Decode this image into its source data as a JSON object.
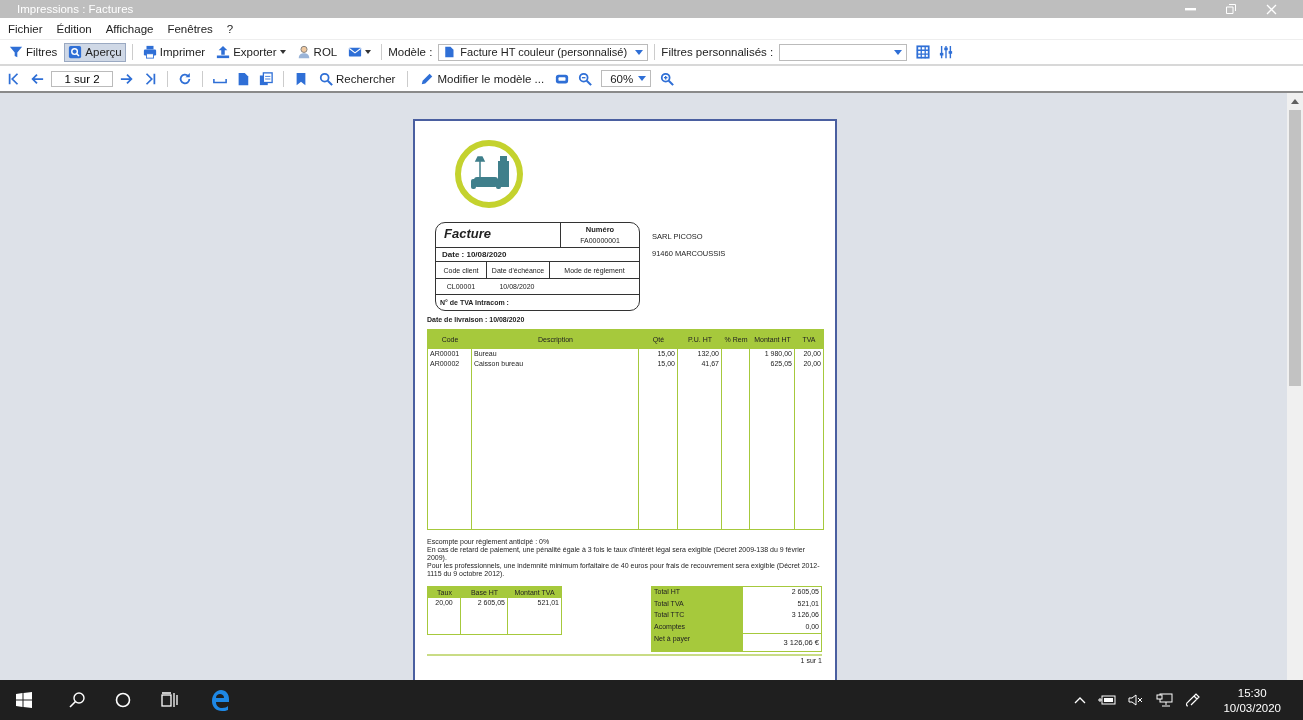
{
  "window": {
    "title": "Impressions : Factures"
  },
  "menu": [
    "Fichier",
    "Édition",
    "Affichage",
    "Fenêtres",
    "?"
  ],
  "toolbar": {
    "buttons": [
      {
        "label": "Filtres",
        "kind": "toggle",
        "selected": false
      },
      {
        "label": "Aperçu",
        "kind": "toggle",
        "selected": true
      },
      {
        "label": "Imprimer",
        "kind": "button"
      },
      {
        "label": "Exporter",
        "kind": "dropdown"
      },
      {
        "label": "ROL",
        "kind": "button"
      },
      {
        "kind": "dropdown"
      }
    ],
    "model_label": "Modèle :",
    "model_value": "Facture HT couleur (personnalisé)",
    "filters_label": "Filtres personnalisés :"
  },
  "navbar": {
    "page_field": "1 sur 2",
    "search_button": "Rechercher",
    "edit_button": "Modifier le modèle ...",
    "zoom": "60%"
  },
  "invoice": {
    "title": "Facture",
    "number_label": "Numéro",
    "number": "FA00000001",
    "date": "Date : 10/08/2020",
    "info_labels": [
      "Code client",
      "Date d'échéance",
      "Mode de règlement"
    ],
    "info_values": [
      "CL00001",
      "10/08/2020"
    ],
    "vat_number": "N° de TVA Intracom :",
    "client": [
      "SARL PICOSO",
      "91460 MARCOUSSIS"
    ],
    "delivery": "Date de livraison : 10/08/2020",
    "columns": [
      "Code",
      "Description",
      "Qté",
      "P.U. HT",
      "% Rem",
      "Montant HT",
      "TVA"
    ],
    "rows": [
      [
        "AR00001",
        "Bureau",
        "15,00",
        "132,00",
        "",
        "1 980,00",
        "20,00"
      ],
      [
        "AR00002",
        "Caisson bureau",
        "15,00",
        "41,67",
        "",
        "625,05",
        "20,00"
      ]
    ],
    "notes": [
      "Escompte pour règlement anticipé : 0%",
      "En cas de retard de paiement, une pénalité égale à 3 fois le taux d'intérêt légal sera exigible (Décret 2009-138 du 9 février 2009).",
      "Pour les professionnels, une indemnité minimum forfaitaire de 40 euros pour frais de recouvrement sera exigible (Décret 2012-1115 du 9 octobre 2012)."
    ],
    "vat_columns": [
      "Taux",
      "Base HT",
      "Montant TVA"
    ],
    "vat_rows": [
      [
        "20,00",
        "2 605,05",
        "521,01"
      ]
    ],
    "totals": [
      {
        "label": "Total HT",
        "value": "2 605,05"
      },
      {
        "label": "Total TVA",
        "value": "521,01"
      },
      {
        "label": "Total TTC",
        "value": "3 126,06"
      },
      {
        "label": "Acomptes",
        "value": "0,00"
      }
    ],
    "net_label": "Net à payer",
    "net_value": "3 126,06 €",
    "page_footer": "1 sur 1"
  },
  "taskbar": {
    "time": "15:30",
    "date": "10/03/2020"
  }
}
